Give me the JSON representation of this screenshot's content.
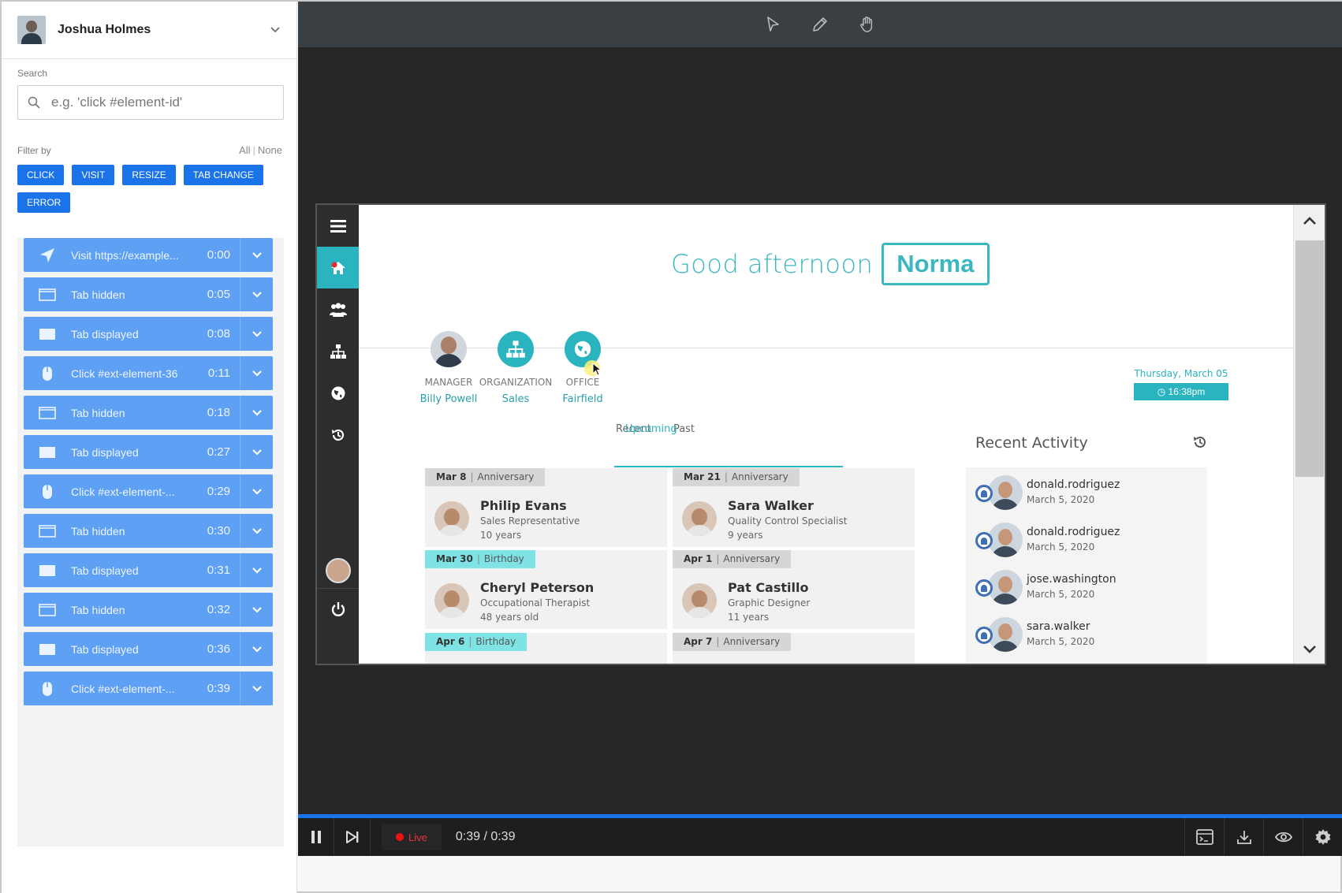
{
  "sidebar": {
    "user_name": "Joshua Holmes",
    "search_label": "Search",
    "search_placeholder": "e.g. 'click #element-id'",
    "filter_label": "Filter by",
    "filter_all": "All",
    "filter_sep": "|",
    "filter_none": "None",
    "filters": [
      "CLICK",
      "VISIT",
      "RESIZE",
      "TAB CHANGE",
      "ERROR"
    ],
    "events": [
      {
        "icon": "navigate-icon",
        "label": "Visit https://example...",
        "time": "0:00"
      },
      {
        "icon": "tab-hidden-icon",
        "label": "Tab hidden",
        "time": "0:05"
      },
      {
        "icon": "tab-displayed-icon",
        "label": "Tab displayed",
        "time": "0:08"
      },
      {
        "icon": "mouse-icon",
        "label": "Click #ext-element-36",
        "time": "0:11"
      },
      {
        "icon": "tab-hidden-icon",
        "label": "Tab hidden",
        "time": "0:18"
      },
      {
        "icon": "tab-displayed-icon",
        "label": "Tab displayed",
        "time": "0:27"
      },
      {
        "icon": "mouse-icon",
        "label": "Click #ext-element-...",
        "time": "0:29"
      },
      {
        "icon": "tab-hidden-icon",
        "label": "Tab hidden",
        "time": "0:30"
      },
      {
        "icon": "tab-displayed-icon",
        "label": "Tab displayed",
        "time": "0:31"
      },
      {
        "icon": "tab-hidden-icon",
        "label": "Tab hidden",
        "time": "0:32"
      },
      {
        "icon": "tab-displayed-icon",
        "label": "Tab displayed",
        "time": "0:36"
      },
      {
        "icon": "mouse-icon",
        "label": "Click #ext-element-...",
        "time": "0:39"
      }
    ]
  },
  "toolbar": {
    "tools": [
      "pointer-icon",
      "pencil-icon",
      "hand-icon"
    ]
  },
  "app": {
    "greeting": "Good afternoon",
    "name": "Norma",
    "info": [
      {
        "caption": "MANAGER",
        "value": "Billy Powell"
      },
      {
        "caption": "ORGANIZATION",
        "value": "Sales"
      },
      {
        "caption": "OFFICE",
        "value": "Fairfield"
      }
    ],
    "date": "Thursday, March 05",
    "clock": "16:38pm",
    "tabs": [
      "Upcoming",
      "Recent",
      "Past"
    ],
    "activity_title": "Recent Activity",
    "cards": [
      {
        "date": "Mar 8",
        "type": "Anniversary",
        "name": "Philip Evans",
        "role": "Sales Representative",
        "years": "10 years"
      },
      {
        "date": "Mar 21",
        "type": "Anniversary",
        "name": "Sara Walker",
        "role": "Quality Control Specialist",
        "years": "9 years"
      },
      {
        "date": "Mar 30",
        "type": "Birthday",
        "name": "Cheryl Peterson",
        "role": "Occupational Therapist",
        "years": "48 years old"
      },
      {
        "date": "Apr 1",
        "type": "Anniversary",
        "name": "Pat Castillo",
        "role": "Graphic Designer",
        "years": "11 years"
      },
      {
        "date": "Apr 6",
        "type": "Birthday"
      },
      {
        "date": "Apr 7",
        "type": "Anniversary"
      }
    ],
    "activity": [
      {
        "user": "donald.rodriguez",
        "date": "March 5, 2020"
      },
      {
        "user": "donald.rodriguez",
        "date": "March 5, 2020"
      },
      {
        "user": "jose.washington",
        "date": "March 5, 2020"
      },
      {
        "user": "sara.walker",
        "date": "March 5, 2020"
      }
    ]
  },
  "player": {
    "live": "Live",
    "time": "0:39 / 0:39",
    "progress": 1.0
  },
  "colors": {
    "accent": "#1a73e8",
    "event": "#5ea0f4",
    "teal": "#2ab4c0"
  }
}
